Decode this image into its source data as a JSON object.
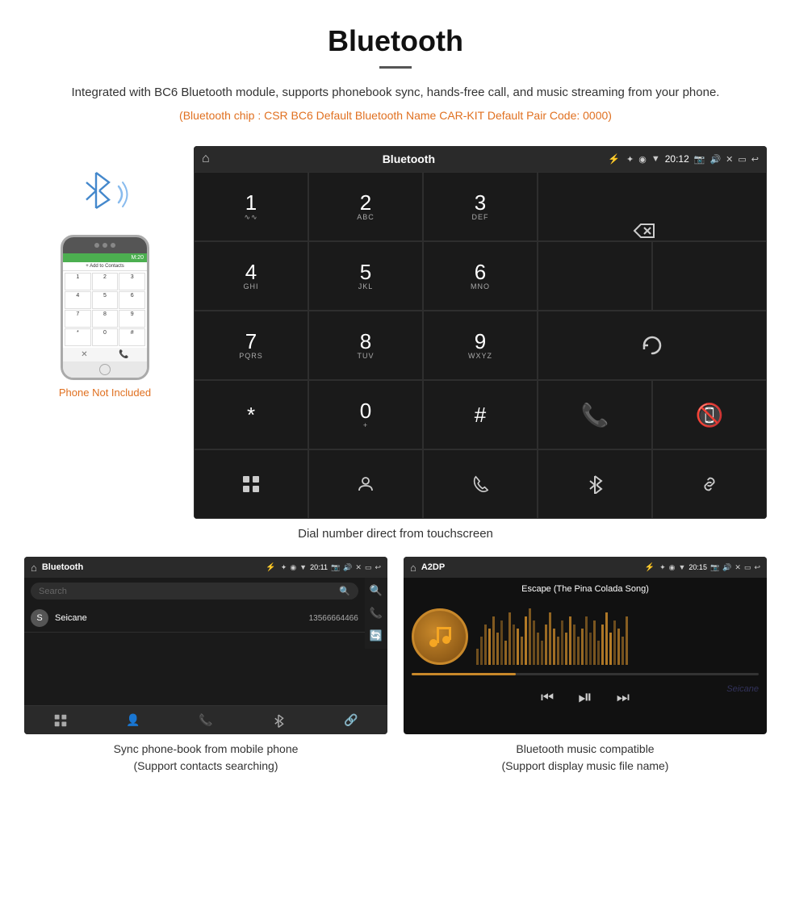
{
  "header": {
    "title": "Bluetooth",
    "description": "Integrated with BC6 Bluetooth module, supports phonebook sync, hands-free call, and music streaming from your phone.",
    "spec": "(Bluetooth chip : CSR BC6   Default Bluetooth Name CAR-KIT    Default Pair Code: 0000)"
  },
  "phone": {
    "not_included_label": "Phone Not Included",
    "screen_header": "M:20",
    "screen_label": "+ Add to Contacts",
    "keys": [
      "1",
      "2",
      "3",
      "4",
      "5",
      "6",
      "7",
      "8",
      "9",
      "*",
      "0",
      "#"
    ]
  },
  "dial_screen": {
    "status_title": "Bluetooth",
    "status_time": "20:12",
    "keys": [
      {
        "num": "1",
        "sub": "∿∿"
      },
      {
        "num": "2",
        "sub": "ABC"
      },
      {
        "num": "3",
        "sub": "DEF"
      },
      {
        "num": "4",
        "sub": "GHI"
      },
      {
        "num": "5",
        "sub": "JKL"
      },
      {
        "num": "6",
        "sub": "MNO"
      },
      {
        "num": "7",
        "sub": "PQRS"
      },
      {
        "num": "8",
        "sub": "TUV"
      },
      {
        "num": "9",
        "sub": "WXYZ"
      },
      {
        "num": "*",
        "sub": ""
      },
      {
        "num": "0",
        "sub": "+"
      },
      {
        "num": "#",
        "sub": ""
      }
    ]
  },
  "dial_caption": "Dial number direct from touchscreen",
  "phonebook": {
    "status_title": "Bluetooth",
    "status_time": "20:11",
    "search_placeholder": "Search",
    "contact_initial": "S",
    "contact_name": "Seicane",
    "contact_number": "13566664466",
    "caption_line1": "Sync phone-book from mobile phone",
    "caption_line2": "(Support contacts searching)"
  },
  "music": {
    "status_title": "A2DP",
    "status_time": "20:15",
    "song_title": "Escape (The Pina Colada Song)",
    "caption_line1": "Bluetooth music compatible",
    "caption_line2": "(Support display music file name)"
  },
  "watermark": "Seicane"
}
